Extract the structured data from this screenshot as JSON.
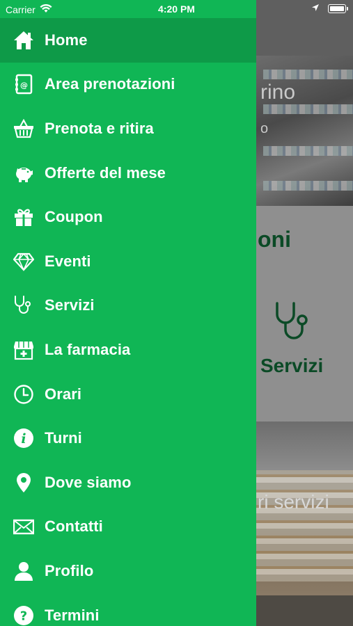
{
  "status_bar": {
    "carrier": "Carrier",
    "time": "4:20 PM"
  },
  "drawer": {
    "background_color": "#10b655",
    "active_color": "#0e9a48",
    "items": [
      {
        "label": "Home",
        "icon": "home-icon",
        "active": true
      },
      {
        "label": "Area prenotazioni",
        "icon": "address-book-icon"
      },
      {
        "label": "Prenota e ritira",
        "icon": "basket-icon"
      },
      {
        "label": "Offerte del mese",
        "icon": "piggy-bank-icon"
      },
      {
        "label": "Coupon",
        "icon": "gift-icon"
      },
      {
        "label": "Eventi",
        "icon": "diamond-icon"
      },
      {
        "label": "Servizi",
        "icon": "stethoscope-icon"
      },
      {
        "label": "La farmacia",
        "icon": "pharmacy-store-icon"
      },
      {
        "label": "Orari",
        "icon": "clock-icon"
      },
      {
        "label": "Turni",
        "icon": "info-icon"
      },
      {
        "label": "Dove siamo",
        "icon": "map-pin-icon"
      },
      {
        "label": "Contatti",
        "icon": "envelope-icon"
      },
      {
        "label": "Profilo",
        "icon": "user-icon"
      },
      {
        "label": "Termini",
        "icon": "question-icon"
      }
    ]
  },
  "background": {
    "card1_title": "rino",
    "card1_subtitle": "o",
    "card2_title": "oni",
    "card2_label": "Servizi",
    "card3_label": "ri servizi"
  }
}
